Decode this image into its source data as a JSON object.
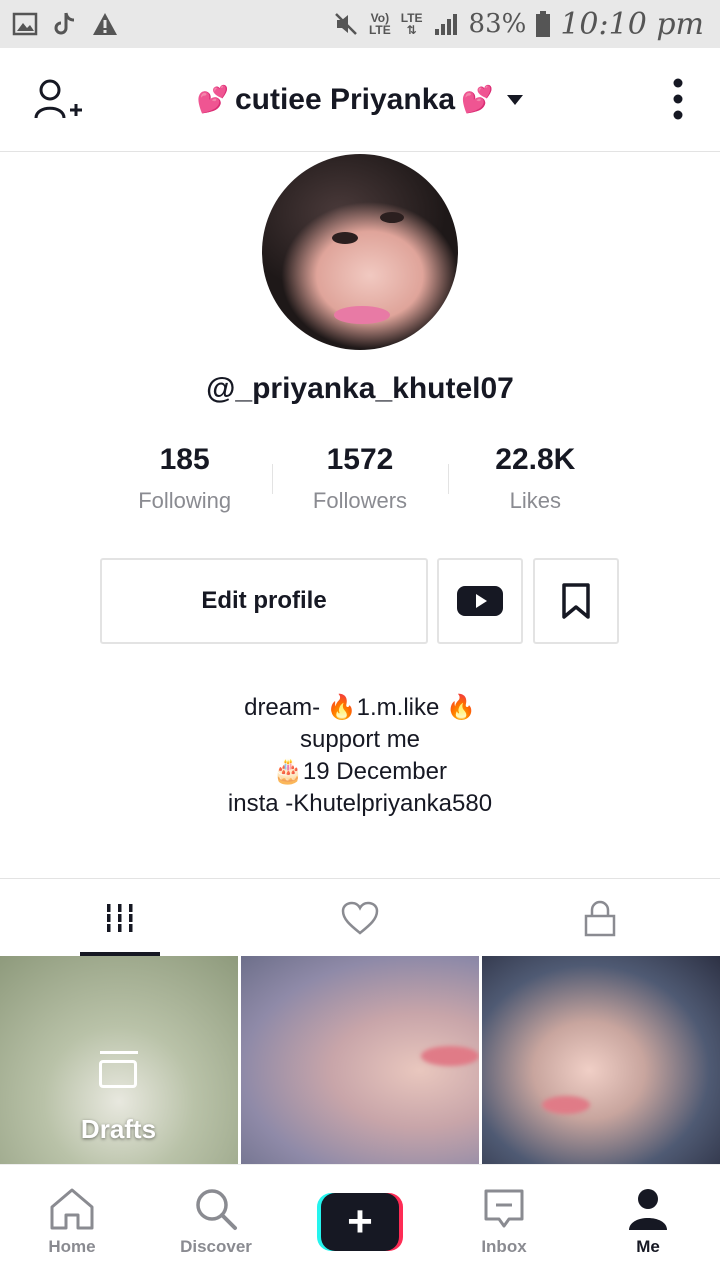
{
  "status_bar": {
    "network_top": "Vo)",
    "network_bottom": "LTE",
    "lte_label": "LTE",
    "battery": "83%",
    "time": "10:10 pm"
  },
  "header": {
    "title": "cutiee Priyanka",
    "title_prefix_emoji": "💕",
    "title_suffix_emoji": "💕"
  },
  "profile": {
    "username": "@_priyanka_khutel07"
  },
  "stats": [
    {
      "value": "185",
      "label": "Following"
    },
    {
      "value": "1572",
      "label": "Followers"
    },
    {
      "value": "22.8K",
      "label": "Likes"
    }
  ],
  "actions": {
    "edit_profile": "Edit profile"
  },
  "bio": [
    "dream- 🔥1.m.like 🔥",
    "support me",
    "🎂19 December",
    "insta -Khutelpriyanka580"
  ],
  "grid": {
    "drafts_label": "Drafts"
  },
  "bottom_nav": [
    {
      "label": "Home",
      "icon": "home-icon"
    },
    {
      "label": "Discover",
      "icon": "search-icon"
    },
    {
      "label": "",
      "icon": "plus-icon"
    },
    {
      "label": "Inbox",
      "icon": "inbox-icon"
    },
    {
      "label": "Me",
      "icon": "person-icon"
    }
  ],
  "colors": {
    "accent_red": "#fe2c55",
    "accent_cyan": "#25f4ee",
    "text_primary": "#161823",
    "text_secondary": "#8a8b91"
  }
}
